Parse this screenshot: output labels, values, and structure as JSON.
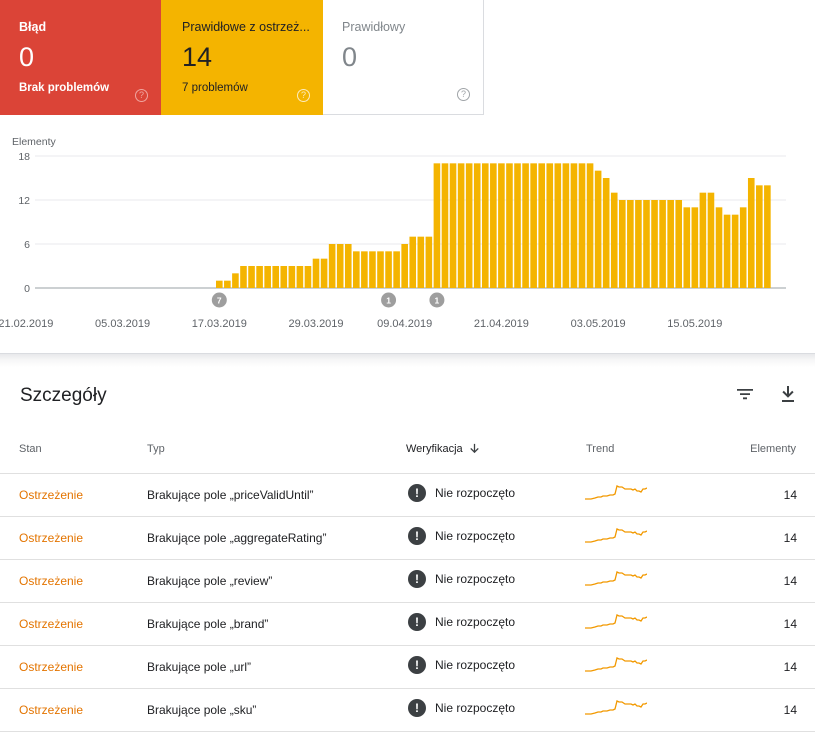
{
  "cards": {
    "error": {
      "label": "Błąd",
      "value": "0",
      "sub": "Brak problemów",
      "color": "#db4437"
    },
    "warning": {
      "label": "Prawidłowe z ostrzeż...",
      "value": "14",
      "sub": "7 problemów",
      "color": "#f4b400"
    },
    "valid": {
      "label": "Prawidłowy",
      "value": "0"
    }
  },
  "chart_data": {
    "type": "bar",
    "ylabel": "Elementy",
    "yticks": [
      0,
      6,
      12,
      18
    ],
    "ylim": [
      0,
      18
    ],
    "color": "#f4b400",
    "x_labels": [
      "21.02.2019",
      "05.03.2019",
      "17.03.2019",
      "29.03.2019",
      "09.04.2019",
      "21.04.2019",
      "03.05.2019",
      "15.05.2019"
    ],
    "x_label_index": [
      0,
      12,
      24,
      36,
      47,
      59,
      71,
      83
    ],
    "values": [
      0,
      0,
      0,
      0,
      0,
      0,
      0,
      0,
      0,
      0,
      0,
      0,
      0,
      0,
      0,
      0,
      0,
      0,
      0,
      0,
      0,
      0,
      0,
      0,
      1,
      1,
      2,
      3,
      3,
      3,
      3,
      3,
      3,
      3,
      3,
      3,
      4,
      4,
      6,
      6,
      6,
      5,
      5,
      5,
      5,
      5,
      5,
      6,
      7,
      7,
      7,
      17,
      17,
      17,
      17,
      17,
      17,
      17,
      17,
      17,
      17,
      17,
      17,
      17,
      17,
      17,
      17,
      17,
      17,
      17,
      17,
      16,
      15,
      13,
      12,
      12,
      12,
      12,
      12,
      12,
      12,
      12,
      11,
      11,
      13,
      13,
      11,
      10,
      10,
      11,
      15,
      14,
      14
    ],
    "annotations": [
      {
        "index": 24,
        "label": "7"
      },
      {
        "index": 45,
        "label": "1"
      },
      {
        "index": 51,
        "label": "1"
      }
    ]
  },
  "details": {
    "title": "Szczegóły",
    "columns": {
      "stan": "Stan",
      "typ": "Typ",
      "weryfikacja": "Weryfikacja",
      "trend": "Trend",
      "elementy": "Elementy"
    },
    "rows": [
      {
        "stan": "Ostrzeżenie",
        "typ": "Brakujące pole „priceValidUntil”",
        "weryfikacja": "Nie rozpoczęto",
        "elementy": "14"
      },
      {
        "stan": "Ostrzeżenie",
        "typ": "Brakujące pole „aggregateRating”",
        "weryfikacja": "Nie rozpoczęto",
        "elementy": "14"
      },
      {
        "stan": "Ostrzeżenie",
        "typ": "Brakujące pole „review”",
        "weryfikacja": "Nie rozpoczęto",
        "elementy": "14"
      },
      {
        "stan": "Ostrzeżenie",
        "typ": "Brakujące pole „brand”",
        "weryfikacja": "Nie rozpoczęto",
        "elementy": "14"
      },
      {
        "stan": "Ostrzeżenie",
        "typ": "Brakujące pole „url”",
        "weryfikacja": "Nie rozpoczęto",
        "elementy": "14"
      },
      {
        "stan": "Ostrzeżenie",
        "typ": "Brakujące pole „sku”",
        "weryfikacja": "Nie rozpoczęto",
        "elementy": "14"
      }
    ]
  }
}
